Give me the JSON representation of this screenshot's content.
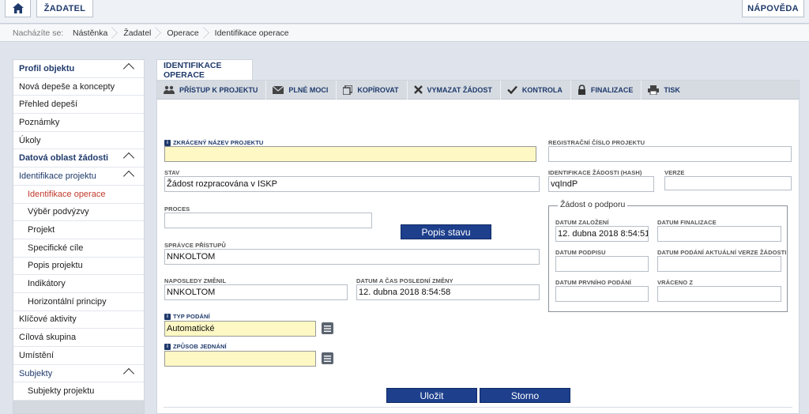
{
  "topbar": {
    "home_icon": "home-icon",
    "user_label": "ŽADATEL",
    "help_label": "NÁPOVĚDA"
  },
  "breadcrumb": {
    "prefix": "Nacházíte se:",
    "items": [
      "Nástěnka",
      "Žadatel",
      "Operace",
      "Identifikace operace"
    ]
  },
  "sidebar": {
    "items": [
      {
        "label": "Profil objektu",
        "type": "section"
      },
      {
        "label": "Nová depeše a koncepty",
        "type": "item"
      },
      {
        "label": "Přehled depeší",
        "type": "item"
      },
      {
        "label": "Poznámky",
        "type": "item"
      },
      {
        "label": "Úkoly",
        "type": "item"
      },
      {
        "label": "Datová oblast žádosti",
        "type": "section"
      },
      {
        "label": "Identifikace projektu",
        "type": "subsection"
      },
      {
        "label": "Identifikace operace",
        "type": "sub-active"
      },
      {
        "label": "Výběr podvýzvy",
        "type": "sub"
      },
      {
        "label": "Projekt",
        "type": "sub"
      },
      {
        "label": "Specifické cíle",
        "type": "sub"
      },
      {
        "label": "Popis projektu",
        "type": "sub"
      },
      {
        "label": "Indikátory",
        "type": "sub"
      },
      {
        "label": "Horizontální principy",
        "type": "sub"
      },
      {
        "label": "Klíčové aktivity",
        "type": "item"
      },
      {
        "label": "Cílová skupina",
        "type": "item"
      },
      {
        "label": "Umístění",
        "type": "item"
      },
      {
        "label": "Subjekty",
        "type": "subsection"
      },
      {
        "label": "Subjekty projektu",
        "type": "sub"
      }
    ]
  },
  "tab": {
    "label": "IDENTIFIKACE OPERACE"
  },
  "toolbar": {
    "access": "PŘÍSTUP K PROJEKTU",
    "powers": "PLNÉ MOCI",
    "copy": "KOPÍROVAT",
    "delete": "VYMAZAT ŽÁDOST",
    "check": "KONTROLA",
    "finalize": "FINALIZACE",
    "print": "TISK"
  },
  "form": {
    "short_name_label": "ZKRÁCENÝ NÁZEV PROJEKTU",
    "short_name_value": "",
    "reg_number_label": "REGISTRAČNÍ ČÍSLO PROJEKTU",
    "reg_number_value": "",
    "state_label": "STAV",
    "state_value": "Žádost rozpracována v ISKP",
    "hash_label": "IDENTIFIKACE ŽÁDOSTI (HASH)",
    "hash_value": "vqIndP",
    "version_label": "VERZE",
    "version_value": "",
    "process_label": "PROCES",
    "process_value": "",
    "state_desc_button": "Popis stavu",
    "access_admin_label": "SPRÁVCE PŘÍSTUPŮ",
    "access_admin_value": "NNKOLTOM",
    "last_changed_by_label": "NAPOSLEDY ZMĚNIL",
    "last_changed_by_value": "NNKOLTOM",
    "last_change_label": "DATUM A ČAS POSLEDNÍ ZMĚNY",
    "last_change_value": "12. dubna 2018 8:54:58",
    "submit_type_label": "TYP PODÁNÍ",
    "submit_type_value": "Automatické",
    "negotiation_label": "ZPŮSOB JEDNÁNÍ",
    "negotiation_value": ""
  },
  "support": {
    "legend": "Žádost o podporu",
    "created_label": "DATUM ZALOŽENÍ",
    "created_value": "12. dubna 2018 8:54:51",
    "finalized_label": "DATUM FINALIZACE",
    "finalized_value": "",
    "signed_label": "DATUM PODPISU",
    "signed_value": "",
    "submitted_current_label": "DATUM PODÁNÍ AKTUÁLNÍ VERZE ŽÁDOSTI",
    "submitted_current_value": "",
    "first_submitted_label": "DATUM PRVNÍHO PODÁNÍ",
    "first_submitted_value": "",
    "returned_label": "VRÁCENO Z",
    "returned_value": ""
  },
  "actions": {
    "save": "Uložit",
    "cancel": "Storno"
  },
  "colors": {
    "accent": "#1d3f8c",
    "required_bg": "#fdf8c4",
    "active_nav": "#c0392b"
  }
}
